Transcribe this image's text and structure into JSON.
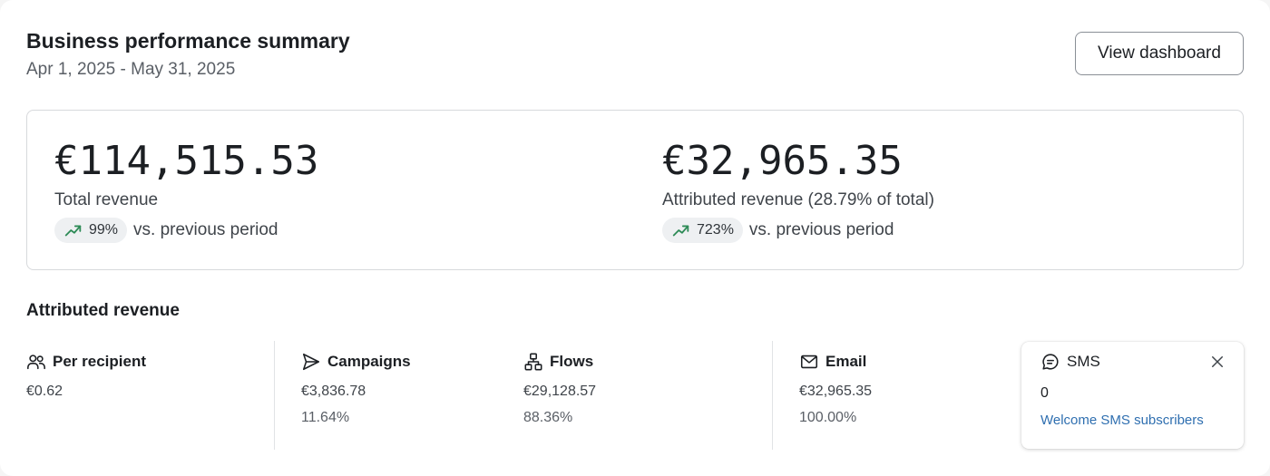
{
  "header": {
    "title": "Business performance summary",
    "date_range": "Apr 1, 2025 - May 31, 2025",
    "view_dashboard_label": "View dashboard"
  },
  "summary": {
    "total": {
      "value": "€114,515.53",
      "label": "Total revenue",
      "change": "99%",
      "comparison": "vs. previous period",
      "trend_icon": "trending-up-icon"
    },
    "attributed": {
      "value": "€32,965.35",
      "label": "Attributed revenue (28.79% of total)",
      "change": "723%",
      "comparison": "vs. previous period",
      "trend_icon": "trending-up-icon"
    }
  },
  "attributed_section": {
    "title": "Attributed revenue",
    "stats": [
      {
        "label": "Per recipient",
        "icon": "users-icon",
        "value": "€0.62",
        "percent": ""
      },
      {
        "label": "Campaigns",
        "icon": "send-icon",
        "value": "€3,836.78",
        "percent": "11.64%"
      },
      {
        "label": "Flows",
        "icon": "flow-icon",
        "value": "€29,128.57",
        "percent": "88.36%"
      },
      {
        "label": "Email",
        "icon": "mail-icon",
        "value": "€32,965.35",
        "percent": "100.00%"
      }
    ],
    "sms": {
      "label": "SMS",
      "icon": "message-icon",
      "value": "0",
      "link": "Welcome SMS subscribers"
    }
  },
  "colors": {
    "trend_up": "#2e8b57",
    "link": "#2f6fb0",
    "border": "#d7d9dc"
  }
}
